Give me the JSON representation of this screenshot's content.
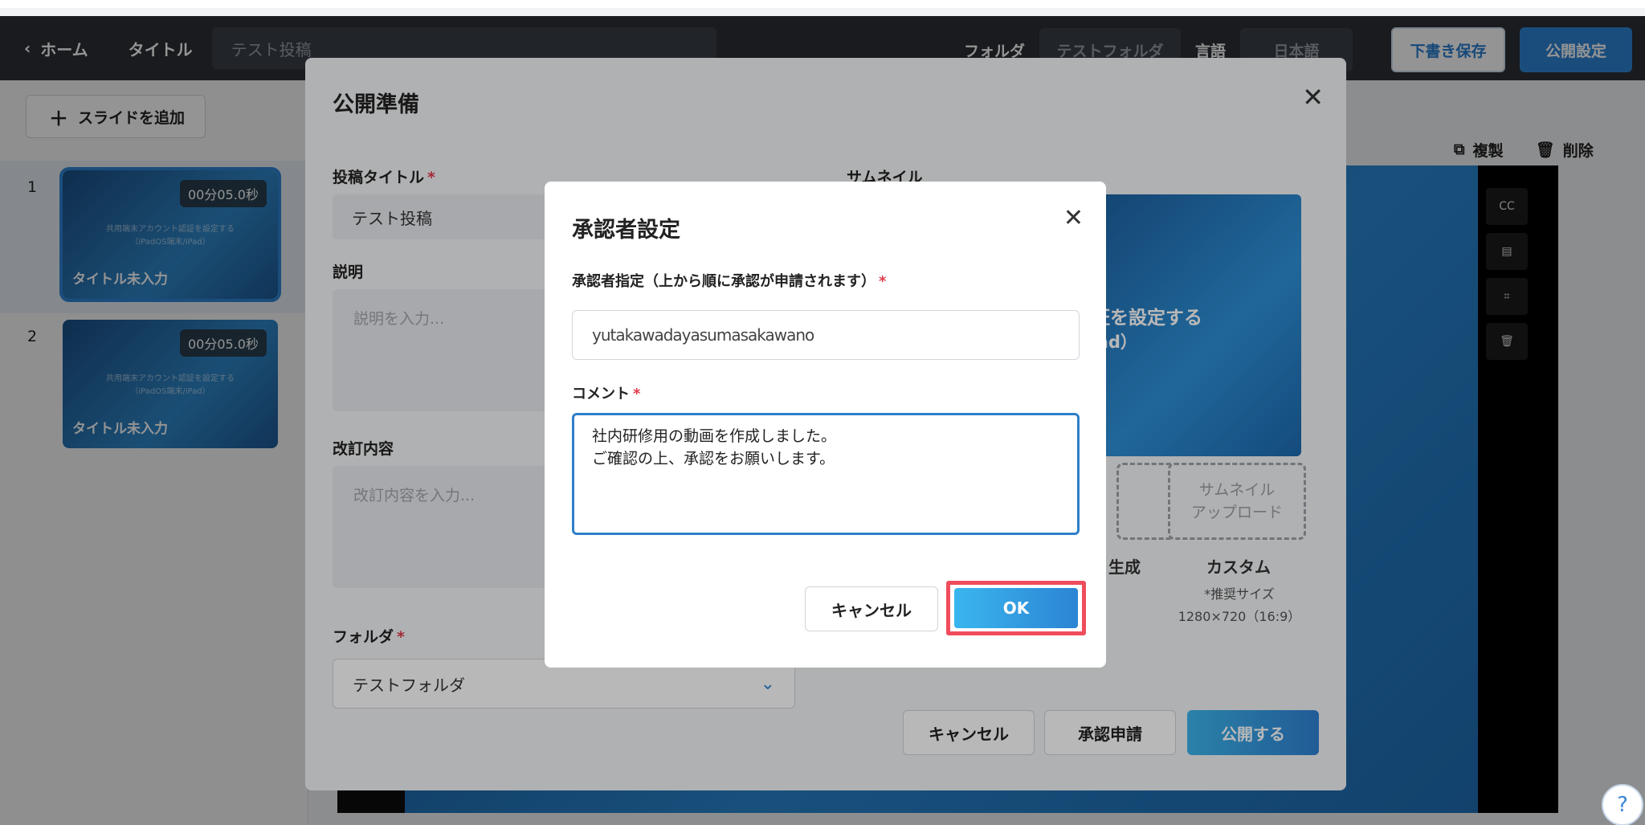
{
  "topbar": {
    "back_label": "ホーム",
    "title_label": "タイトル",
    "title_value": "テスト投稿",
    "folder_label": "フォルダ",
    "folder_value": "テストフォルダ",
    "language_label": "言語",
    "language_value": "日本語",
    "draft_button": "下書き保存",
    "publish_settings_button": "公開設定"
  },
  "sidebar": {
    "add_slide": "スライドを追加",
    "slides": [
      {
        "number": "1",
        "duration": "00分05.0秒",
        "title": "タイトル未入力",
        "mini_text_1": "共用端末アカウント認証を設定する",
        "mini_text_2": "（iPadOS端末/iPad）"
      },
      {
        "number": "2",
        "duration": "00分05.0秒",
        "title": "タイトル未入力",
        "mini_text_1": "共用端末アカウント認証を設定する",
        "mini_text_2": "（iPadOS端末/iPad）"
      }
    ]
  },
  "editor_toolbar": {
    "duplicate": "複製",
    "delete": "削除"
  },
  "publish_modal": {
    "title": "公開準備",
    "post_title_label": "投稿タイトル",
    "post_title_value": "テスト投稿",
    "description_label": "説明",
    "description_placeholder": "説明を入力...",
    "revision_label": "改訂内容",
    "revision_placeholder": "改訂内容を入力...",
    "folder_label": "フォルダ",
    "folder_value": "テストフォルダ",
    "thumbnail_label": "サムネイル",
    "thumbnail_text_1": "認証を設定する",
    "thumbnail_text_2": "/iPad）",
    "auto_generate_caption": "生成",
    "upload_box": "サムネイル\nアップロード",
    "custom_caption": "カスタム",
    "recommended_size_1": "*推奨サイズ",
    "recommended_size_2": "1280×720（16:9）",
    "cancel_button": "キャンセル",
    "approval_button": "承認申請",
    "publish_button": "公開する"
  },
  "approver_dialog": {
    "title": "承認者設定",
    "approver_label": "承認者指定（上から順に承認が申請されます）",
    "approver_value": "yutakawadayasumasakawano",
    "comment_label": "コメント",
    "comment_value": "社内研修用の動画を作成しました。\nご確認の上、承認をお願いします。",
    "cancel_button": "キャンセル",
    "ok_button": "OK"
  },
  "help": "?",
  "colors": {
    "accent": "#2f86d6",
    "highlight": "#ef4d5c",
    "required": "#e03b4b"
  }
}
